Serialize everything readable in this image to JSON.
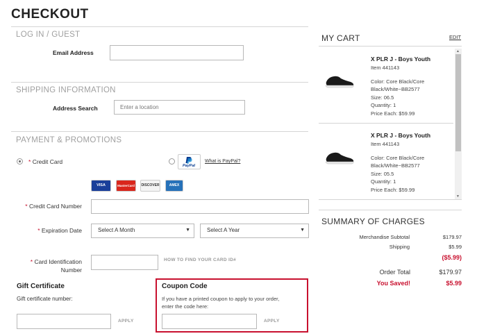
{
  "page": {
    "title": "CHECKOUT"
  },
  "login": {
    "section_title": "LOG IN / GUEST",
    "email_label": "Email Address",
    "email_value": ""
  },
  "shipping": {
    "section_title": "SHIPPING INFORMATION",
    "address_label": "Address Search",
    "address_placeholder": "Enter a location"
  },
  "payment": {
    "section_title": "PAYMENT & PROMOTIONS",
    "credit_card_option": "Credit Card",
    "paypal_link": "What is PayPal?",
    "paypal_logo_text": "PayPal",
    "card_logos": [
      "VISA",
      "MasterCard",
      "DISCOVER",
      "AMEX"
    ],
    "card_number_label": "Credit Card Number",
    "expiration_label": "Expiration Date",
    "month_select": "Select A Month",
    "year_select": "Select A Year",
    "card_id_label_line1": "Card Identification",
    "card_id_label_line2": "Number",
    "card_id_help": "HOW TO FIND YOUR CARD ID#",
    "required_mark": "*"
  },
  "gift": {
    "title": "Gift Certificate",
    "field_label": "Gift certificate number:",
    "apply": "APPLY"
  },
  "coupon": {
    "title": "Coupon Code",
    "description_line1": "If you have a printed coupon to apply to your order,",
    "description_line2": "enter the code here:",
    "apply": "APPLY"
  },
  "cart": {
    "title": "MY CART",
    "edit": "EDIT",
    "items": [
      {
        "name": "X PLR J - Boys Youth",
        "item_no": "Item 441143",
        "color_line1": "Color: Core Black/Core",
        "color_line2": "Black/White~BB2577",
        "size": "Size: 06.5",
        "quantity": "Quantity: 1",
        "price": "Price Each: $59.99"
      },
      {
        "name": "X PLR J - Boys Youth",
        "item_no": "Item 441143",
        "color_line1": "Color: Core Black/Core",
        "color_line2": "Black/White~BB2577",
        "size": "Size: 05.5",
        "quantity": "Quantity: 1",
        "price": "Price Each: $59.99"
      }
    ]
  },
  "summary": {
    "title": "SUMMARY OF CHARGES",
    "merch_label": "Merchandise Subtotal",
    "merch_value": "$179.97",
    "shipping_label": "Shipping",
    "shipping_value": "$5.99",
    "discount_value": "($5.99)",
    "total_label": "Order Total",
    "total_value": "$179.97",
    "saved_label": "You Saved!",
    "saved_value": "$5.99"
  },
  "colors": {
    "accent_red": "#c8102e",
    "section_gray": "#a0a0a0"
  }
}
